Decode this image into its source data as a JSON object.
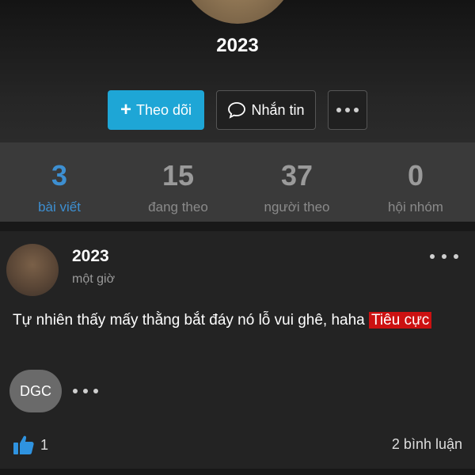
{
  "profile": {
    "name": "2023",
    "follow_label": "Theo dõi",
    "message_label": "Nhắn tin"
  },
  "stats": [
    {
      "value": "3",
      "label": "bài viết",
      "active": true
    },
    {
      "value": "15",
      "label": "đang theo",
      "active": false
    },
    {
      "value": "37",
      "label": "người theo",
      "active": false
    },
    {
      "value": "0",
      "label": "hội nhóm",
      "active": false
    }
  ],
  "post": {
    "author": "2023",
    "time": "một giờ",
    "text": "Tự nhiên thấy mấy thằng bắt đáy nó lỗ vui ghê, haha",
    "sentiment_tag": "Tiêu cực",
    "commenter_initials": "DGC",
    "like_count": "1",
    "comment_count": "2 bình luận"
  },
  "colors": {
    "accent": "#1ea6d6",
    "active_stat": "#3d8fd1",
    "negative_tag": "#cc1111"
  },
  "icons": {
    "follow": "plus-icon",
    "message": "chat-bubble-icon",
    "more": "more-horizontal-icon",
    "like": "thumbs-up-icon"
  }
}
